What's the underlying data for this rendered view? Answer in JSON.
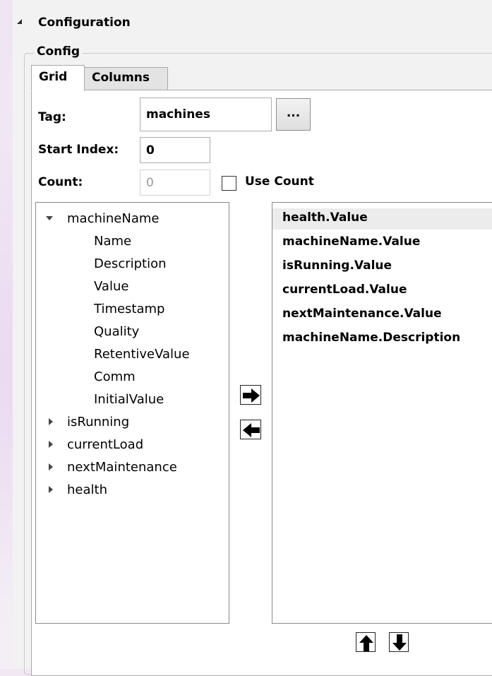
{
  "section": {
    "title": "Configuration"
  },
  "groupbox": {
    "legend": "Config"
  },
  "tabs": [
    {
      "label": "Grid",
      "active": true
    },
    {
      "label": "Columns",
      "active": false
    }
  ],
  "form": {
    "tag_label": "Tag:",
    "tag_value": "machines",
    "browse_label": "...",
    "start_index_label": "Start Index:",
    "start_index_value": "0",
    "count_label": "Count:",
    "count_value": "0",
    "use_count_label": "Use Count",
    "use_count_checked": false
  },
  "tree": {
    "items": [
      {
        "label": "machineName",
        "expanded": true,
        "children": [
          "Name",
          "Description",
          "Value",
          "Timestamp",
          "Quality",
          "RetentiveValue",
          "Comm",
          "InitialValue"
        ]
      },
      {
        "label": "isRunning",
        "expanded": false
      },
      {
        "label": "currentLoad",
        "expanded": false
      },
      {
        "label": "nextMaintenance",
        "expanded": false
      },
      {
        "label": "health",
        "expanded": false
      }
    ]
  },
  "selected_columns": [
    "health.Value",
    "machineName.Value",
    "isRunning.Value",
    "currentLoad.Value",
    "nextMaintenance.Value",
    "machineName.Description"
  ],
  "icons": {
    "collapse": "triangle-collapse-icon",
    "add": "arrow-right-icon",
    "remove": "arrow-left-icon",
    "move_up": "arrow-up-icon",
    "move_down": "arrow-down-icon"
  }
}
